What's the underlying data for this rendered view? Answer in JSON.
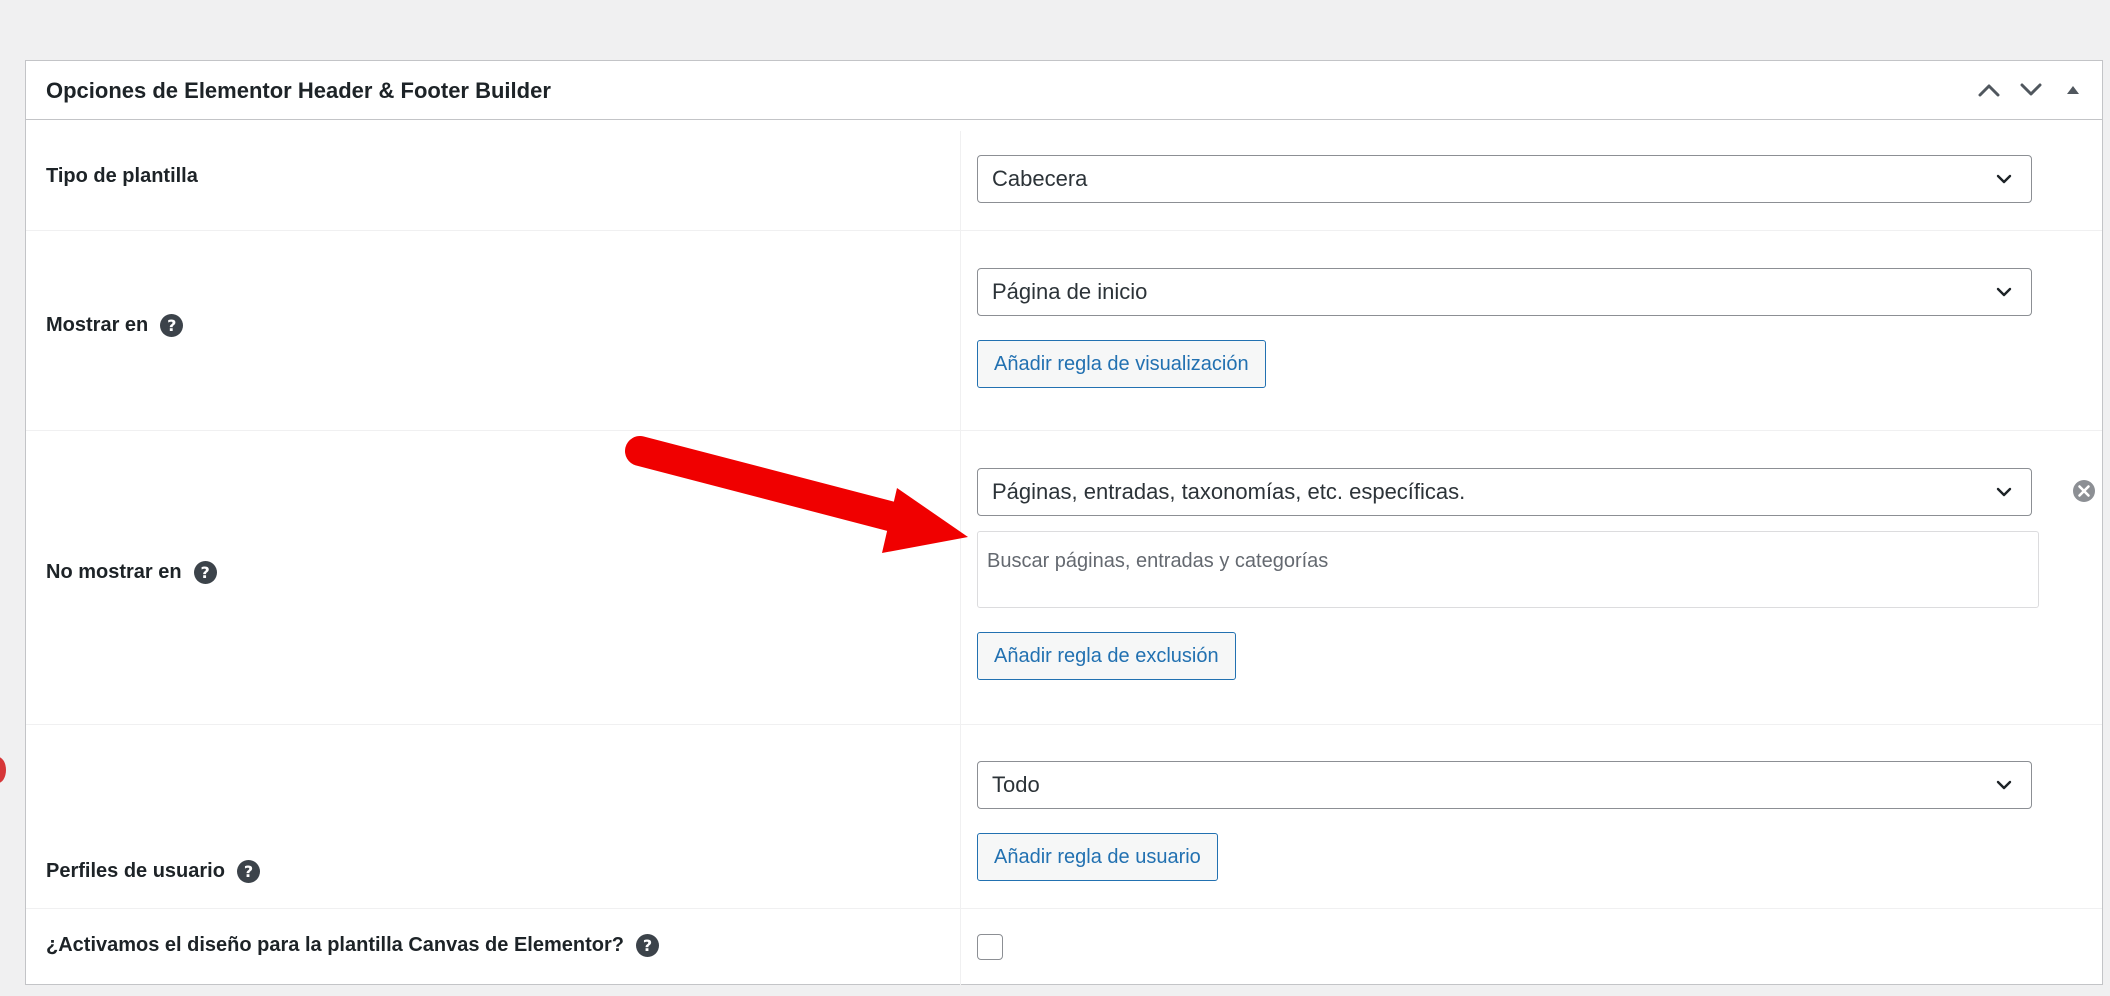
{
  "metabox": {
    "title": "Opciones de Elementor Header & Footer Builder",
    "controls": [
      "chevron-up-icon",
      "chevron-down-icon",
      "triangle-up-icon"
    ]
  },
  "rows": {
    "template_type": {
      "label": "Tipo de plantilla",
      "selected": "Cabecera"
    },
    "display_on": {
      "label": "Mostrar en",
      "help_icon": "?",
      "selected": "Página de inicio",
      "button": "Añadir regla de visualización"
    },
    "exclude_on": {
      "label": "No mostrar en",
      "help_icon": "?",
      "selected": "Páginas, entradas, taxonomías, etc. específicas.",
      "search_placeholder": "Buscar páginas, entradas y categorías",
      "button": "Añadir regla de exclusión"
    },
    "user_roles": {
      "label": "Perfiles de usuario",
      "help_icon": "?",
      "selected": "Todo",
      "button": "Añadir regla de usuario"
    },
    "canvas": {
      "label": "¿Activamos el diseño para la plantilla Canvas de Elementor?",
      "help_icon": "?",
      "checked": false
    }
  },
  "colors": {
    "accent": "#2271b1",
    "annotation_arrow": "#f00000",
    "notification_dot": "#d63638"
  }
}
